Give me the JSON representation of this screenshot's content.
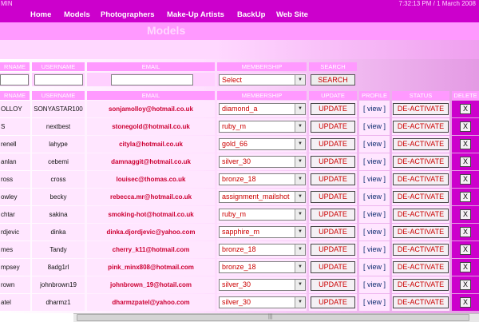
{
  "topbar": {
    "left": "MIN",
    "right": "7:32:13 PM / 1 March 2008"
  },
  "nav": [
    "Home",
    "Models",
    "Photographers",
    "Make-Up Artists",
    "BackUp",
    "Web Site"
  ],
  "page_title": "Models",
  "filter_headers": [
    "RNAME",
    "USERNAME",
    "EMAIL",
    "MEMBERSHIP",
    "SEARCH"
  ],
  "filter": {
    "select_value": "Select",
    "search_label": "SEARCH"
  },
  "table_headers": [
    "RNAME",
    "USERNAME",
    "EMAIL",
    "MEMBERSHIP",
    "UPDATE",
    "PROFILE",
    "STATUS",
    "DELETE"
  ],
  "buttons": {
    "update": "UPDATE",
    "view": "[ view ]",
    "status": "DE-ACTIVATE",
    "delete": "X"
  },
  "rows": [
    {
      "rname": "OLLOY",
      "username": "SONYASTAR100",
      "email": "sonjamolloy@hotmail.co.uk",
      "membership": "diamond_a"
    },
    {
      "rname": "S",
      "username": "nextbest",
      "email": "stonegold@hotmail.co.uk",
      "membership": "ruby_m"
    },
    {
      "rname": "renell",
      "username": "lahype",
      "email": "cityla@hotmail.co.uk",
      "membership": "gold_66"
    },
    {
      "rname": "anlan",
      "username": "cebemi",
      "email": "damnaggit@hotmail.co.uk",
      "membership": "silver_30"
    },
    {
      "rname": "ross",
      "username": "cross",
      "email": "louisec@thomas.co.uk",
      "membership": "bronze_18"
    },
    {
      "rname": "owley",
      "username": "becky",
      "email": "rebecca.mr@hotmail.co.uk",
      "membership": "assignment_mailshot"
    },
    {
      "rname": "chtar",
      "username": "sakina",
      "email": "smoking-hot@hotmail.co.uk",
      "membership": "ruby_m"
    },
    {
      "rname": "rdjevic",
      "username": "dinka",
      "email": "dinka.djordjevic@yahoo.com",
      "membership": "sapphire_m"
    },
    {
      "rname": "mes",
      "username": "Tandy",
      "email": "cherry_k11@hotmail.com",
      "membership": "bronze_18"
    },
    {
      "rname": "mpsey",
      "username": "8adg1rl",
      "email": "pink_minx808@hotmail.com",
      "membership": "bronze_18"
    },
    {
      "rname": "rown",
      "username": "johnbrown19",
      "email": "johnbrown_19@hotail.com",
      "membership": "silver_30"
    },
    {
      "rname": "atel",
      "username": "dharmz1",
      "email": "dharmzpatel@yahoo.com",
      "membership": "silver_30"
    }
  ]
}
